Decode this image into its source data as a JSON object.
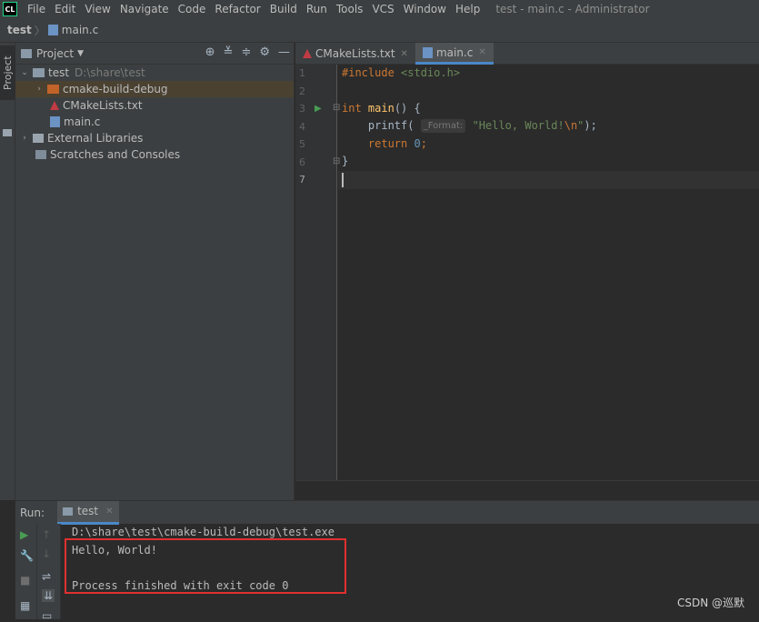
{
  "app": {
    "logo": "CL",
    "menu": [
      "File",
      "Edit",
      "View",
      "Navigate",
      "Code",
      "Refactor",
      "Build",
      "Run",
      "Tools",
      "VCS",
      "Window",
      "Help"
    ],
    "window_title": "test - main.c - Administrator"
  },
  "breadcrumb": {
    "project": "test",
    "file": "main.c"
  },
  "left_strip": {
    "project_tab": "Project"
  },
  "project_panel": {
    "title": "Project",
    "tree": [
      {
        "label": "test",
        "extra": "D:\\share\\test"
      },
      {
        "label": "cmake-build-debug"
      },
      {
        "label": "CMakeLists.txt"
      },
      {
        "label": "main.c"
      },
      {
        "label": "External Libraries"
      },
      {
        "label": "Scratches and Consoles"
      }
    ]
  },
  "editor": {
    "tabs": [
      {
        "label": "CMakeLists.txt"
      },
      {
        "label": "main.c"
      }
    ],
    "line_numbers": [
      "1",
      "2",
      "3",
      "4",
      "5",
      "6",
      "7"
    ],
    "code": {
      "l1_directive": "#include",
      "l1_header": " <stdio.h>",
      "l3_kw": "int",
      "l3_fn": " main",
      "l3_rest": "() {",
      "l4_fn": "    printf(",
      "l4_hint": "_Format:",
      "l4_str": "\"Hello, World!",
      "l4_esc": "\\n",
      "l4_strend": "\"",
      "l4_end": ");",
      "l5_kw": "    return",
      "l5_num": " 0",
      "l5_end": ";",
      "l6": "}"
    }
  },
  "run_panel": {
    "label": "Run:",
    "tab": "test",
    "output": [
      "D:\\share\\test\\cmake-build-debug\\test.exe",
      "Hello, World!",
      "",
      "Process finished with exit code 0"
    ]
  },
  "watermark": "CSDN @巡默",
  "colors": {
    "highlight_box": "#e03030",
    "accent": "#4a88c7"
  }
}
